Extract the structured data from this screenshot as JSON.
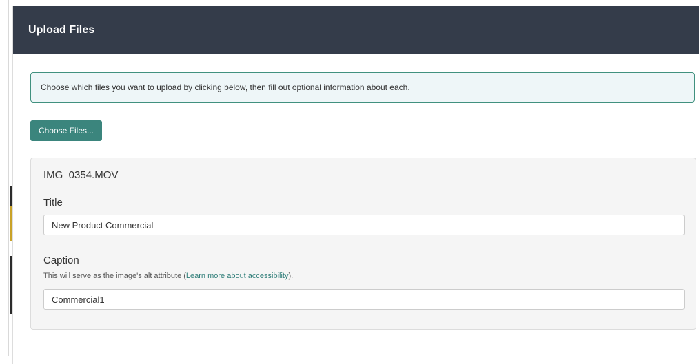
{
  "modal": {
    "title": "Upload Files",
    "instructions": "Choose which files you want to upload by clicking below, then fill out optional information about each.",
    "choose_button_label": "Choose Files..."
  },
  "file": {
    "name": "IMG_0354.MOV",
    "title_label": "Title",
    "title_value": "New Product Commercial",
    "caption_label": "Caption",
    "caption_help_prefix": "This will serve as the image's alt attribute (",
    "caption_help_link": "Learn more about accessibility",
    "caption_help_suffix": ").",
    "caption_value": "Commercial1"
  },
  "colors": {
    "header_bg": "#343c4a",
    "accent": "#3b857d",
    "alert_border": "#41917f",
    "alert_bg": "#eef6f8",
    "panel_bg": "#f5f5f5"
  }
}
